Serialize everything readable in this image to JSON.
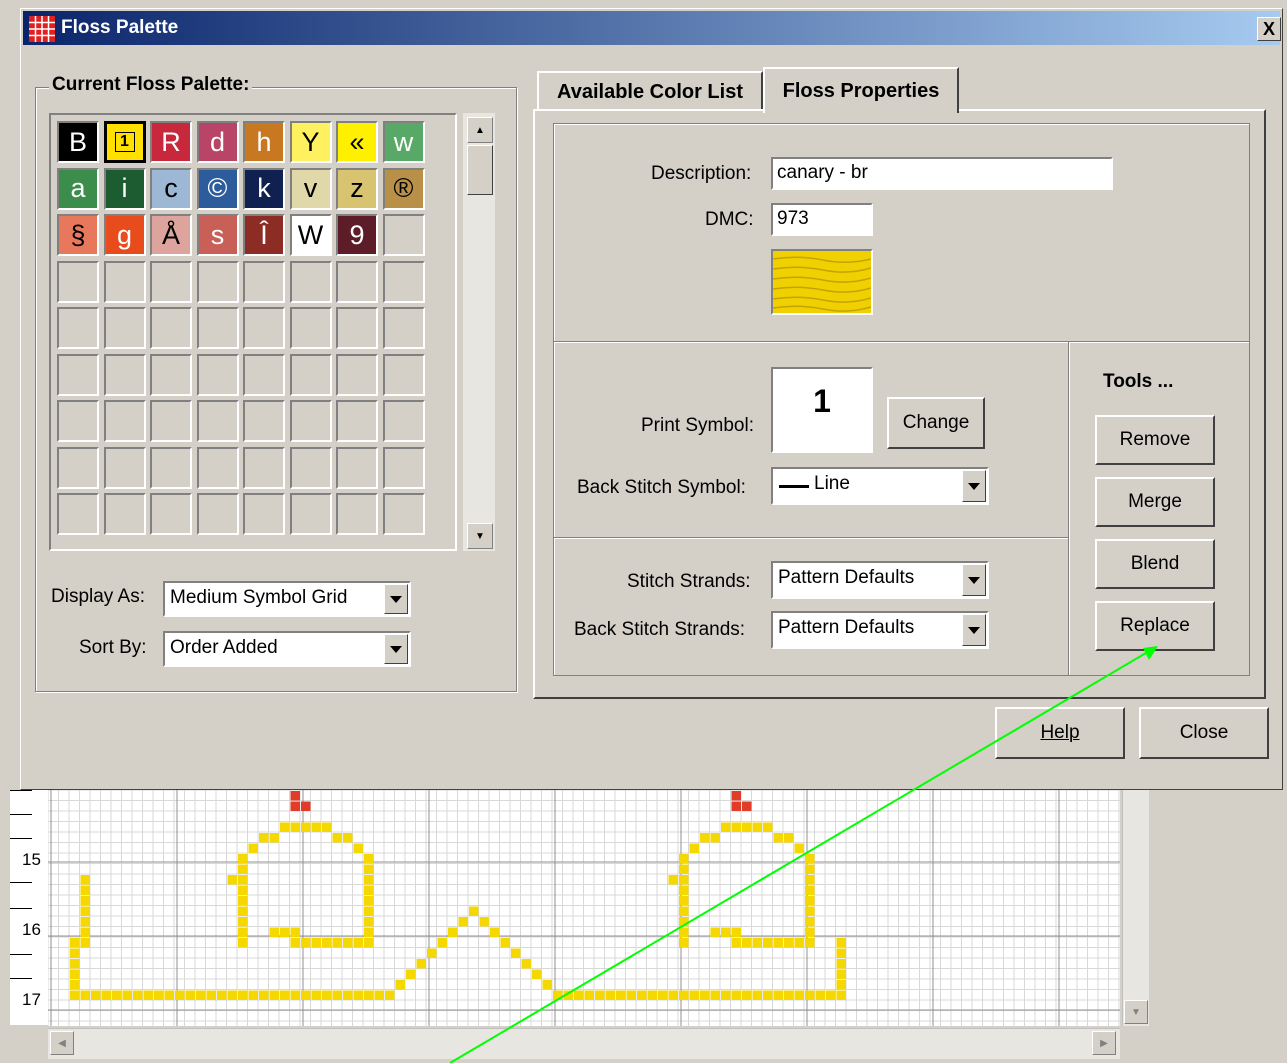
{
  "dialog": {
    "title": "Floss Palette",
    "close_glyph": "X"
  },
  "palette": {
    "group_label": "Current Floss Palette:",
    "cells": [
      {
        "symbol": "B",
        "bg": "#000000",
        "fg": "#ffffff",
        "selected": false
      },
      {
        "symbol": "1",
        "bg": "#ffe000",
        "fg": "#000000",
        "selected": true
      },
      {
        "symbol": "R",
        "bg": "#c8283c",
        "fg": "#ffffff",
        "selected": false
      },
      {
        "symbol": "d",
        "bg": "#b84468",
        "fg": "#ffffff",
        "selected": false
      },
      {
        "symbol": "h",
        "bg": "#c87820",
        "fg": "#ffffff",
        "selected": false
      },
      {
        "symbol": "Y",
        "bg": "#fff060",
        "fg": "#000000",
        "selected": false
      },
      {
        "symbol": "«",
        "bg": "#fff000",
        "fg": "#000000",
        "selected": false
      },
      {
        "symbol": "w",
        "bg": "#58a868",
        "fg": "#ffffff",
        "selected": false
      },
      {
        "symbol": "a",
        "bg": "#3c8c4c",
        "fg": "#ffffff",
        "selected": false
      },
      {
        "symbol": "i",
        "bg": "#1c5c30",
        "fg": "#ffffff",
        "selected": false
      },
      {
        "symbol": "c",
        "bg": "#9cb8d4",
        "fg": "#000000",
        "selected": false
      },
      {
        "symbol": "©",
        "bg": "#2c5c9c",
        "fg": "#ffffff",
        "selected": false
      },
      {
        "symbol": "k",
        "bg": "#102050",
        "fg": "#ffffff",
        "selected": false
      },
      {
        "symbol": "v",
        "bg": "#e0d8a8",
        "fg": "#000000",
        "selected": false
      },
      {
        "symbol": "z",
        "bg": "#d8c470",
        "fg": "#000000",
        "selected": false
      },
      {
        "symbol": "®",
        "bg": "#b89048",
        "fg": "#000000",
        "selected": false
      },
      {
        "symbol": "§",
        "bg": "#e8785c",
        "fg": "#000000",
        "selected": false
      },
      {
        "symbol": "g",
        "bg": "#e84c1c",
        "fg": "#ffffff",
        "selected": false
      },
      {
        "symbol": "Å",
        "bg": "#dca49c",
        "fg": "#000000",
        "selected": false
      },
      {
        "symbol": "s",
        "bg": "#c86058",
        "fg": "#ffffff",
        "selected": false
      },
      {
        "symbol": "Î",
        "bg": "#8c2c24",
        "fg": "#ffffff",
        "selected": false
      },
      {
        "symbol": "W",
        "bg": "#ffffff",
        "fg": "#000000",
        "selected": false
      },
      {
        "symbol": "9",
        "bg": "#5c1c28",
        "fg": "#ffffff",
        "selected": false
      }
    ],
    "display_as_label": "Display As:",
    "display_as_value": "Medium Symbol Grid",
    "sort_by_label": "Sort By:",
    "sort_by_value": "Order Added"
  },
  "tabs": [
    {
      "label": "Available Color List",
      "active": false
    },
    {
      "label": "Floss Properties",
      "active": true
    }
  ],
  "properties": {
    "description_label": "Description:",
    "description_value": "canary - br",
    "dmc_label": "DMC:",
    "dmc_value": "973",
    "swatch_color": "#f0d000",
    "print_symbol_label": "Print Symbol:",
    "print_symbol_value": "1",
    "change_button": "Change",
    "back_stitch_symbol_label": "Back Stitch Symbol:",
    "back_stitch_symbol_value": "Line",
    "stitch_strands_label": "Stitch Strands:",
    "stitch_strands_value": "Pattern Defaults",
    "back_stitch_strands_label": "Back Stitch Strands:",
    "back_stitch_strands_value": "Pattern Defaults"
  },
  "tools": {
    "label": "Tools ...",
    "remove": "Remove",
    "merge": "Merge",
    "blend": "Blend",
    "replace": "Replace"
  },
  "footer": {
    "help_label": "Help",
    "close_label": "Close"
  },
  "ruler": {
    "labels": [
      "15",
      "16",
      "17"
    ]
  },
  "colors": {
    "stitch_yellow": "#f5d800",
    "stitch_red": "#e03c28",
    "annotation_arrow": "#00ff00"
  }
}
